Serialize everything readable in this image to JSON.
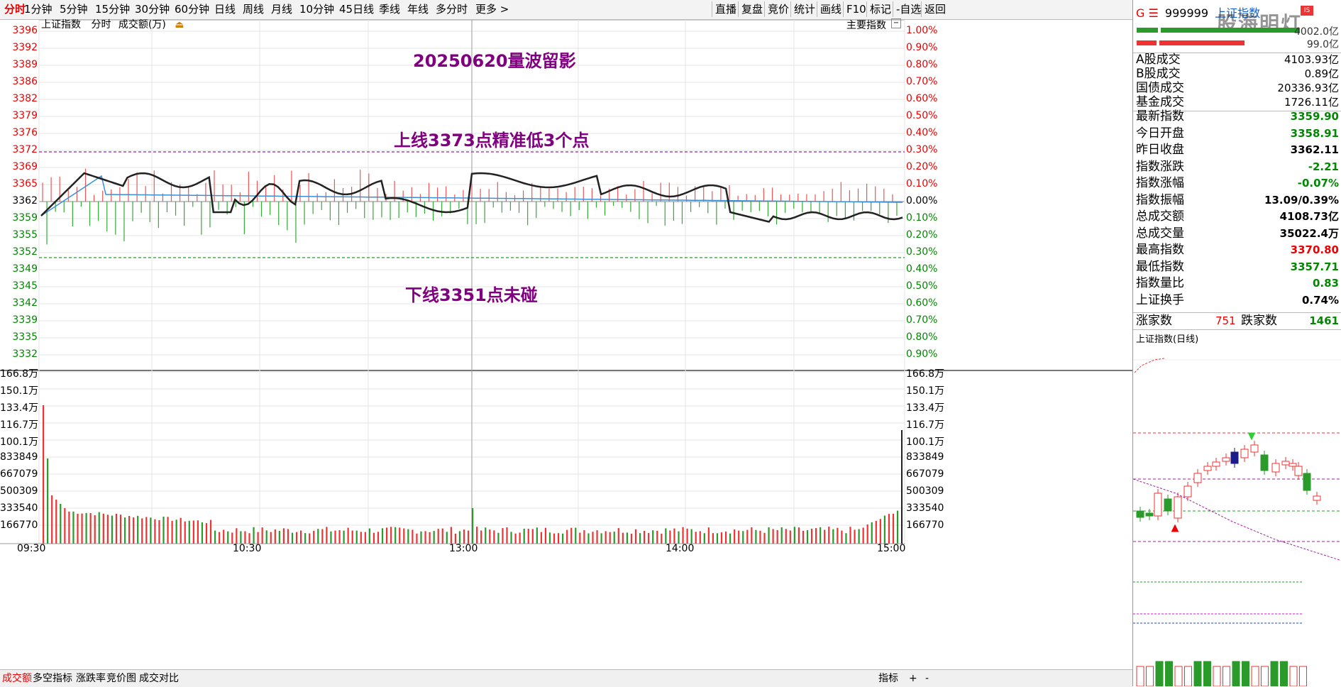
{
  "toolbar": {
    "left": [
      "分时",
      "1分钟",
      "5分钟",
      "15分钟",
      "30分钟",
      "60分钟",
      "日线",
      "周线",
      "月线",
      "10分钟",
      "45日线",
      "季线",
      "年线",
      "多分时",
      "更多 >"
    ],
    "right": [
      "直播",
      "复盘",
      "竞价",
      "统计",
      "画线",
      "F10",
      "标记",
      "-自选",
      "返回"
    ]
  },
  "chart_header": {
    "index_name": "上证指数",
    "period": "分时",
    "metric": "成交额(万)",
    "main_indicator": "主要指数"
  },
  "price_axis": {
    "left": [
      "3396",
      "3392",
      "3389",
      "3386",
      "3382",
      "3379",
      "3376",
      "3372",
      "3369",
      "3365",
      "3362",
      "3359",
      "3355",
      "3352",
      "3349",
      "3345",
      "3342",
      "3339",
      "3335",
      "3332"
    ],
    "right": [
      "1.00%",
      "0.90%",
      "0.80%",
      "0.70%",
      "0.60%",
      "0.50%",
      "0.40%",
      "0.30%",
      "0.20%",
      "0.10%",
      "0.00%",
      "0.10%",
      "0.20%",
      "0.30%",
      "0.40%",
      "0.50%",
      "0.60%",
      "0.70%",
      "0.80%",
      "0.90%"
    ]
  },
  "volume_axis": [
    "166.8万",
    "150.1万",
    "133.4万",
    "116.7万",
    "100.1万",
    "833849",
    "667079",
    "500309",
    "333540",
    "166770"
  ],
  "time_axis": [
    "09:30",
    "10:30",
    "13:00",
    "14:00",
    "15:00"
  ],
  "annotations": {
    "title": "20250620量波留影",
    "upper": "上线3373点精准低3个点",
    "lower": "下线3351点未碰"
  },
  "bottom_tabs": [
    "成交额",
    "多空指标",
    "涨跌率",
    "竞价图",
    "成交对比"
  ],
  "bottom_right": [
    "指标",
    "+",
    "-"
  ],
  "right_panel": {
    "code_prefix": "G ☰",
    "code": "999999",
    "name": "上证指数",
    "watermark": "股海明灯",
    "bar_value1": "4002.0亿",
    "bar_value2": "99.0亿",
    "turnover": [
      {
        "k": "A股成交",
        "v": "4103.93亿"
      },
      {
        "k": "B股成交",
        "v": "0.89亿"
      },
      {
        "k": "国债成交",
        "v": "20336.93亿"
      },
      {
        "k": "基金成交",
        "v": "1726.11亿"
      }
    ],
    "quote": [
      {
        "k": "最新指数",
        "v": "3359.90",
        "c": "green"
      },
      {
        "k": "今日开盘",
        "v": "3358.91",
        "c": "green"
      },
      {
        "k": "昨日收盘",
        "v": "3362.11",
        "c": "black"
      },
      {
        "k": "指数涨跌",
        "v": "-2.21",
        "c": "green"
      },
      {
        "k": "指数涨幅",
        "v": "-0.07%",
        "c": "green"
      },
      {
        "k": "指数振幅",
        "v": "13.09/0.39%",
        "c": "black"
      },
      {
        "k": "总成交额",
        "v": "4108.73亿",
        "c": "black"
      },
      {
        "k": "总成交量",
        "v": "35022.4万",
        "c": "black"
      },
      {
        "k": "最高指数",
        "v": "3370.80",
        "c": "red"
      },
      {
        "k": "最低指数",
        "v": "3357.71",
        "c": "green"
      },
      {
        "k": "指数量比",
        "v": "0.83",
        "c": "green"
      },
      {
        "k": "上证换手",
        "v": "0.74%",
        "c": "black"
      }
    ],
    "breadth": {
      "up_label": "涨家数",
      "up": "751",
      "down_label": "跌家数",
      "down": "1461"
    },
    "kline_title": "上证指数(日线)"
  },
  "colors": {
    "up": "#e00000",
    "down": "#008000",
    "price_line": "#222222",
    "avg_line": "#3a8fd8",
    "annot": "#800080"
  }
}
